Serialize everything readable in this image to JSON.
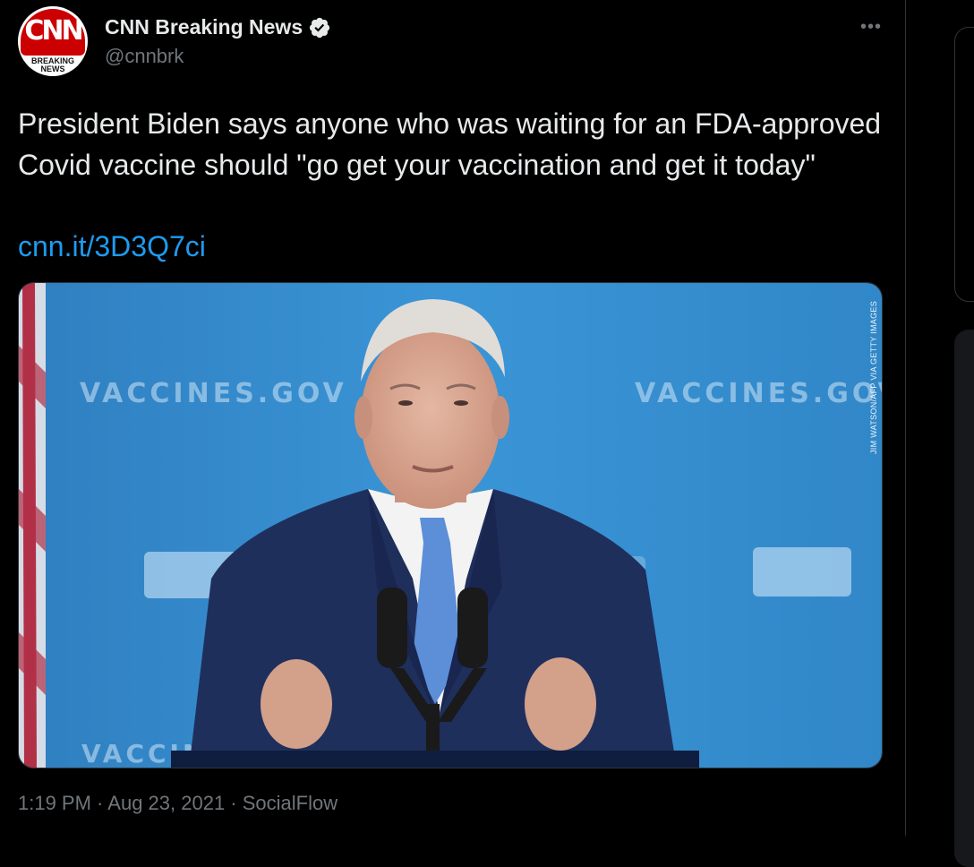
{
  "author": {
    "display_name": "CNN Breaking News",
    "handle": "@cnnbrk",
    "avatar": {
      "logo_text": "CNN",
      "sub_text_line1": "BREAKING",
      "sub_text_line2": "NEWS",
      "brand_color": "#cc0000"
    },
    "verified_icon": "verified-badge-icon"
  },
  "more_icon": "more-horizontal-icon",
  "tweet": {
    "text": "President Biden says anyone who was waiting for an FDA-approved Covid vaccine should \"go get your vaccination and get it today\"",
    "link": "cnn.it/3D3Q7ci"
  },
  "media": {
    "credit": "JIM WATSON/AFP VIA GETTY IMAGES",
    "backdrop_text": "VACCINES.GOV"
  },
  "meta": {
    "time": "1:19 PM",
    "separator": " · ",
    "date": "Aug 23, 2021",
    "source": "SocialFlow"
  },
  "colors": {
    "background": "#000000",
    "text_primary": "#e7e9ea",
    "text_secondary": "#71767b",
    "link": "#1d9bf0",
    "border": "#2f3336"
  }
}
